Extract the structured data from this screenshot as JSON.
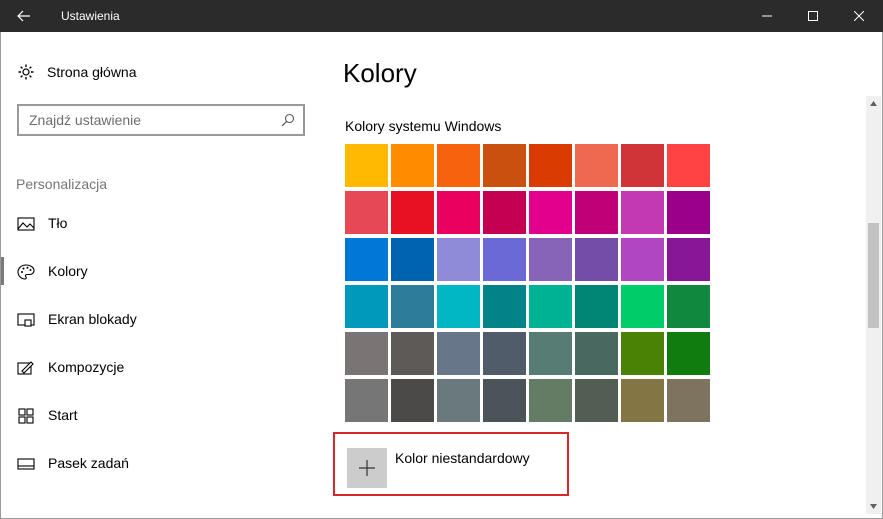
{
  "window": {
    "title": "Ustawienia",
    "controls": [
      "minimize-icon",
      "maximize-icon",
      "close-icon"
    ]
  },
  "sidebar": {
    "home_label": "Strona główna",
    "search_placeholder": "Znajdź ustawienie",
    "section_label": "Personalizacja",
    "items": [
      {
        "label": "Tło",
        "icon": "picture-icon",
        "active": false
      },
      {
        "label": "Kolory",
        "icon": "palette-icon",
        "active": true
      },
      {
        "label": "Ekran blokady",
        "icon": "lock-screen-icon",
        "active": false
      },
      {
        "label": "Kompozycje",
        "icon": "themes-icon",
        "active": false
      },
      {
        "label": "Start",
        "icon": "start-icon",
        "active": false
      },
      {
        "label": "Pasek zadań",
        "icon": "taskbar-icon",
        "active": false
      }
    ]
  },
  "main": {
    "title": "Kolory",
    "section_title": "Kolory systemu Windows",
    "custom_color_label": "Kolor niestandardowy",
    "swatches": [
      [
        "#FFB900",
        "#FF8C00",
        "#F7630C",
        "#CA5010",
        "#DA3B01",
        "#EF6950",
        "#D13438",
        "#FF4343"
      ],
      [
        "#E74856",
        "#E81123",
        "#EA005E",
        "#C30052",
        "#E3008C",
        "#BF0077",
        "#C239B3",
        "#9A0089"
      ],
      [
        "#0078D7",
        "#0063B1",
        "#8E8CD8",
        "#6B69D6",
        "#8764B8",
        "#744DA9",
        "#B146C2",
        "#881798"
      ],
      [
        "#0099BC",
        "#2D7D9A",
        "#00B7C3",
        "#038387",
        "#00B294",
        "#018574",
        "#00CC6A",
        "#10893E"
      ],
      [
        "#7A7574",
        "#5D5A58",
        "#68768A",
        "#515C6B",
        "#567C73",
        "#486860",
        "#498205",
        "#107C10"
      ],
      [
        "#767676",
        "#4C4A48",
        "#69797E",
        "#4A5459",
        "#647C64",
        "#525E54",
        "#847545",
        "#7E735F"
      ]
    ]
  },
  "colors": {
    "titlebar": "#2B2B2B",
    "highlight_border": "#D9262C",
    "active_indicator": "#7A7A7A"
  }
}
